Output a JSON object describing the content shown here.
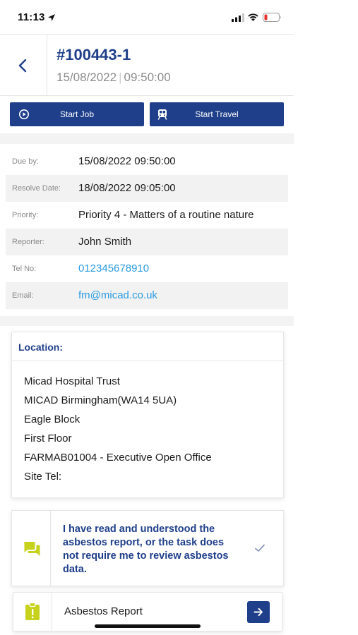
{
  "status_bar": {
    "time": "11:13"
  },
  "header": {
    "job_number": "#100443-1",
    "date": "15/08/2022",
    "time": "09:50:00"
  },
  "actions": {
    "start_job_label": "Start Job",
    "start_travel_label": "Start Travel"
  },
  "details": [
    {
      "label": "Due by:",
      "value": "15/08/2022 09:50:00",
      "link": false
    },
    {
      "label": "Resolve Date:",
      "value": "18/08/2022 09:05:00",
      "link": false
    },
    {
      "label": "Priority:",
      "value": "Priority 4 - Matters of a routine nature",
      "link": false
    },
    {
      "label": "Reporter:",
      "value": "John Smith",
      "link": false
    },
    {
      "label": "Tel No:",
      "value": "012345678910",
      "link": true
    },
    {
      "label": "Email:",
      "value": "fm@micad.co.uk",
      "link": true
    }
  ],
  "location": {
    "title": "Location:",
    "lines": [
      "Micad Hospital Trust",
      "MICAD Birmingham(WA14 5UA)",
      "Eagle Block",
      "First Floor",
      "FARMAB01004 - Executive Open Office",
      "Site Tel:"
    ]
  },
  "asbestos_ack": {
    "text": "I have read and understood the asbestos report, or the task does not require me to review asbestos data."
  },
  "asbestos_report": {
    "label": "Asbestos Report"
  },
  "colors": {
    "primary": "#1f3f8a",
    "link": "#2a9be0",
    "icon_accent": "#c6d21c",
    "row_alt": "#f2f2f2"
  },
  "icons": {
    "back": "chevron-left-icon",
    "start_job": "play-circle-icon",
    "start_travel": "train-icon",
    "acknowledge": "chat-bubbles-icon",
    "check": "check-icon",
    "report": "clipboard-alert-icon",
    "go": "arrow-right-icon"
  }
}
